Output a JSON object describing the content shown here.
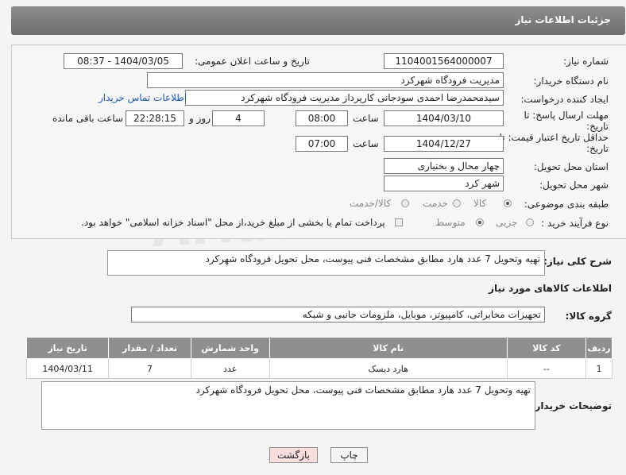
{
  "header": {
    "title": "جزئیات اطلاعات نیاز"
  },
  "fields": {
    "need_number_label": "شماره نیاز:",
    "need_number": "1104001564000007",
    "announce_label": "تاریخ و ساعت اعلان عمومی:",
    "announce_value": "1404/03/05 - 08:37",
    "buyer_org_label": "نام دستگاه خریدار:",
    "buyer_org": "مدیریت فرودگاه شهرکرد",
    "creator_label": "ایجاد کننده درخواست:",
    "creator": "سیدمحمدرضا احمدی سودجانی کارپرداز مدیریت فرودگاه شهرکرد",
    "contact_link": "اطلاعات تماس خریدار",
    "deadline_label": "مهلت ارسال پاسخ: تا تاریخ:",
    "deadline_date": "1404/03/10",
    "time_label": "ساعت",
    "deadline_time": "08:00",
    "days": "4",
    "days_label": "روز و",
    "remaining_time": "22:28:15",
    "remaining_label": "ساعت باقی مانده",
    "price_validity_label": "حداقل تاریخ اعتبار قیمت: تا تاریخ:",
    "price_validity_date": "1404/12/27",
    "price_validity_time": "07:00",
    "province_label": "استان محل تحویل:",
    "province": "چهار محال و بختیاری",
    "city_label": "شهر محل تحویل:",
    "city": "شهر کرد",
    "category_label": "طبقه بندی موضوعی:",
    "category_options": [
      "کالا",
      "خدمت",
      "کالا/خدمت"
    ],
    "process_label": "نوع فرآیند خرید :",
    "process_options": [
      "جزیی",
      "متوسط"
    ],
    "payment_note": "پرداخت تمام یا بخشی از مبلغ خرید،از محل \"اسناد خزانه اسلامی\" خواهد بود."
  },
  "summary": {
    "label": "شرح کلی نیاز:",
    "value": "تهیه وتحویل 7 عدد هارد مطابق مشخصات فنی پیوست، محل تحویل فرودگاه شهرکرد"
  },
  "goods_section_title": "اطلاعات کالاهای مورد نیاز",
  "goods_group": {
    "label": "گروه کالا:",
    "value": "تجهیزات مخابراتی، کامپیوتر، موبایل، ملزومات جانبی و شبکه"
  },
  "table": {
    "headers": [
      "ردیف",
      "کد کالا",
      "نام کالا",
      "واحد شمارش",
      "تعداد / مقدار",
      "تاریخ نیاز"
    ],
    "rows": [
      [
        "1",
        "--",
        "هارد دیسک",
        "عدد",
        "7",
        "1404/03/11"
      ]
    ]
  },
  "buyer_notes": {
    "label": "توضیحات خریدار:",
    "value": "تهیه وتحویل 7 عدد هارد مطابق مشخصات فنی پیوست، محل تحویل فرودگاه شهرکرد"
  },
  "buttons": {
    "print": "چاپ",
    "back": "بازگشت"
  },
  "watermark": "AriaTender.net",
  "colors": {
    "header": "#7d7d7d",
    "table_header": "#8f8f8f",
    "link": "#1e5bb8",
    "back_button": "#f9dede"
  }
}
